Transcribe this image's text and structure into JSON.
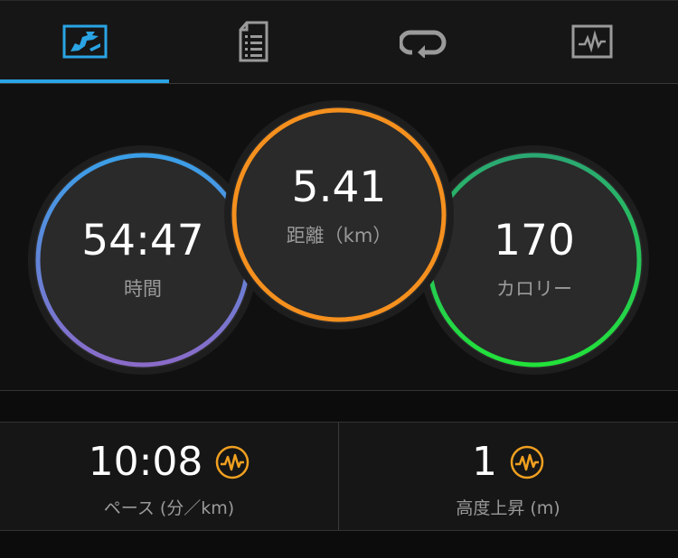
{
  "tabs": [
    {
      "icon": "summary-map-icon",
      "active": true
    },
    {
      "icon": "details-list-icon",
      "active": false
    },
    {
      "icon": "laps-loop-icon",
      "active": false
    },
    {
      "icon": "charts-graph-icon",
      "active": false
    }
  ],
  "rings": {
    "time": {
      "value": "54:47",
      "label": "時間"
    },
    "distance": {
      "value": "5.41",
      "label": "距離（km）"
    },
    "calories": {
      "value": "170",
      "label": "カロリー"
    }
  },
  "stats": {
    "pace": {
      "value": "10:08",
      "label": "ペース (分／km)",
      "icon": "heart-rate-pulse-icon"
    },
    "elevation": {
      "value": "1",
      "label": "高度上昇 (m)",
      "icon": "heart-rate-pulse-icon"
    }
  },
  "colors": {
    "accent_blue": "#2aa4e4",
    "ring_time_top": "#3a9fe8",
    "ring_time_bottom": "#8a6bc9",
    "ring_distance": "#f5901e",
    "ring_calories_top": "#2aa873",
    "ring_calories_bottom": "#22e23a",
    "pulse_icon": "#f0a020"
  }
}
